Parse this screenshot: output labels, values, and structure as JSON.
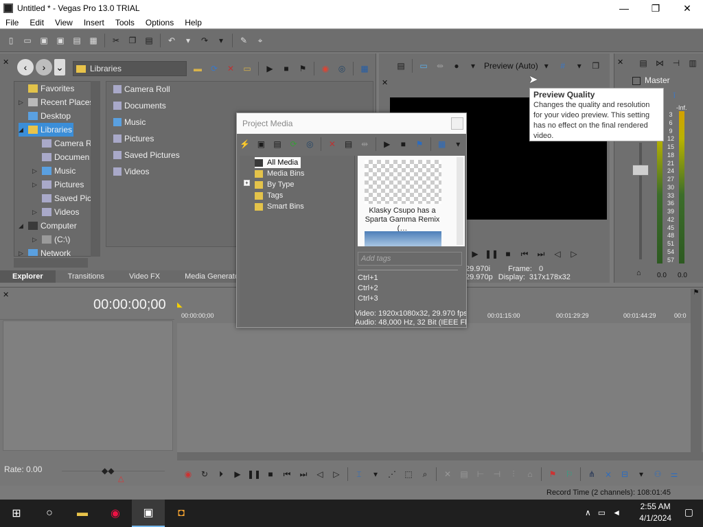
{
  "window": {
    "title": "Untitled * - Vegas Pro 13.0 TRIAL",
    "minimize": "—",
    "maximize": "❐",
    "close": "✕"
  },
  "menu": [
    "File",
    "Edit",
    "View",
    "Insert",
    "Tools",
    "Options",
    "Help"
  ],
  "explorer": {
    "address": "Libraries",
    "tree": [
      {
        "label": "Favorites",
        "indent": 1
      },
      {
        "label": "Recent Places",
        "indent": 1
      },
      {
        "label": "Desktop",
        "indent": 1
      },
      {
        "label": "Libraries",
        "indent": 1,
        "selected": true
      },
      {
        "label": "Camera R",
        "indent": 2
      },
      {
        "label": "Documen",
        "indent": 2
      },
      {
        "label": "Music",
        "indent": 2
      },
      {
        "label": "Pictures",
        "indent": 2
      },
      {
        "label": "Saved Pic",
        "indent": 2
      },
      {
        "label": "Videos",
        "indent": 2
      },
      {
        "label": "Computer",
        "indent": 1
      },
      {
        "label": "(C:\\)",
        "indent": 2
      },
      {
        "label": "Network",
        "indent": 1
      }
    ],
    "files": [
      "Camera Roll",
      "Documents",
      "Music",
      "Pictures",
      "Saved Pictures",
      "Videos"
    ],
    "tabs": [
      "Explorer",
      "Transitions",
      "Video FX",
      "Media Generato"
    ]
  },
  "preview": {
    "quality_label": "Preview (Auto)",
    "info": {
      "frame_label": "Frame:",
      "frame_value": "0",
      "display_label": "Display:",
      "display_value": "317x178x32",
      "fps1": "29.970i",
      "fps2": "29.970p"
    }
  },
  "tooltip": {
    "title": "Preview Quality",
    "body": "Changes the quality and resolution for your video preview. This setting has no effect on the final rendered video."
  },
  "master": {
    "title": "Master",
    "inf_label": "-Inf.",
    "scale": [
      "3",
      "6",
      "9",
      "12",
      "15",
      "18",
      "21",
      "24",
      "27",
      "30",
      "33",
      "36",
      "39",
      "42",
      "45",
      "48",
      "51",
      "54",
      "57"
    ],
    "left_value": "0.0",
    "right_value": "0.0"
  },
  "project_media": {
    "title": "Project Media",
    "tree": [
      "All Media",
      "Media Bins",
      "By Type",
      "Tags",
      "Smart Bins"
    ],
    "thumb_caption": "Klasky Csupo has a Sparta Gamma Remix (…",
    "tags_placeholder": "Add tags",
    "shortcuts": [
      "Ctrl+1",
      "Ctrl+2",
      "Ctrl+3"
    ],
    "video_info": "Video: 1920x1080x32, 29.970 fps",
    "audio_info": "Audio: 48,000 Hz, 32 Bit (IEEE Flo"
  },
  "timeline": {
    "timecode": "00:00:00;00",
    "ruler": [
      "00:00:00;00",
      "00:01:15:00",
      "00:01:29:29",
      "00:01:44:29",
      "00:0"
    ],
    "rate": "Rate: 0.00"
  },
  "status": {
    "record_time": "Record Time (2 channels): 108:01:45"
  },
  "taskbar": {
    "time": "2:55 AM",
    "date": "4/1/2024"
  }
}
